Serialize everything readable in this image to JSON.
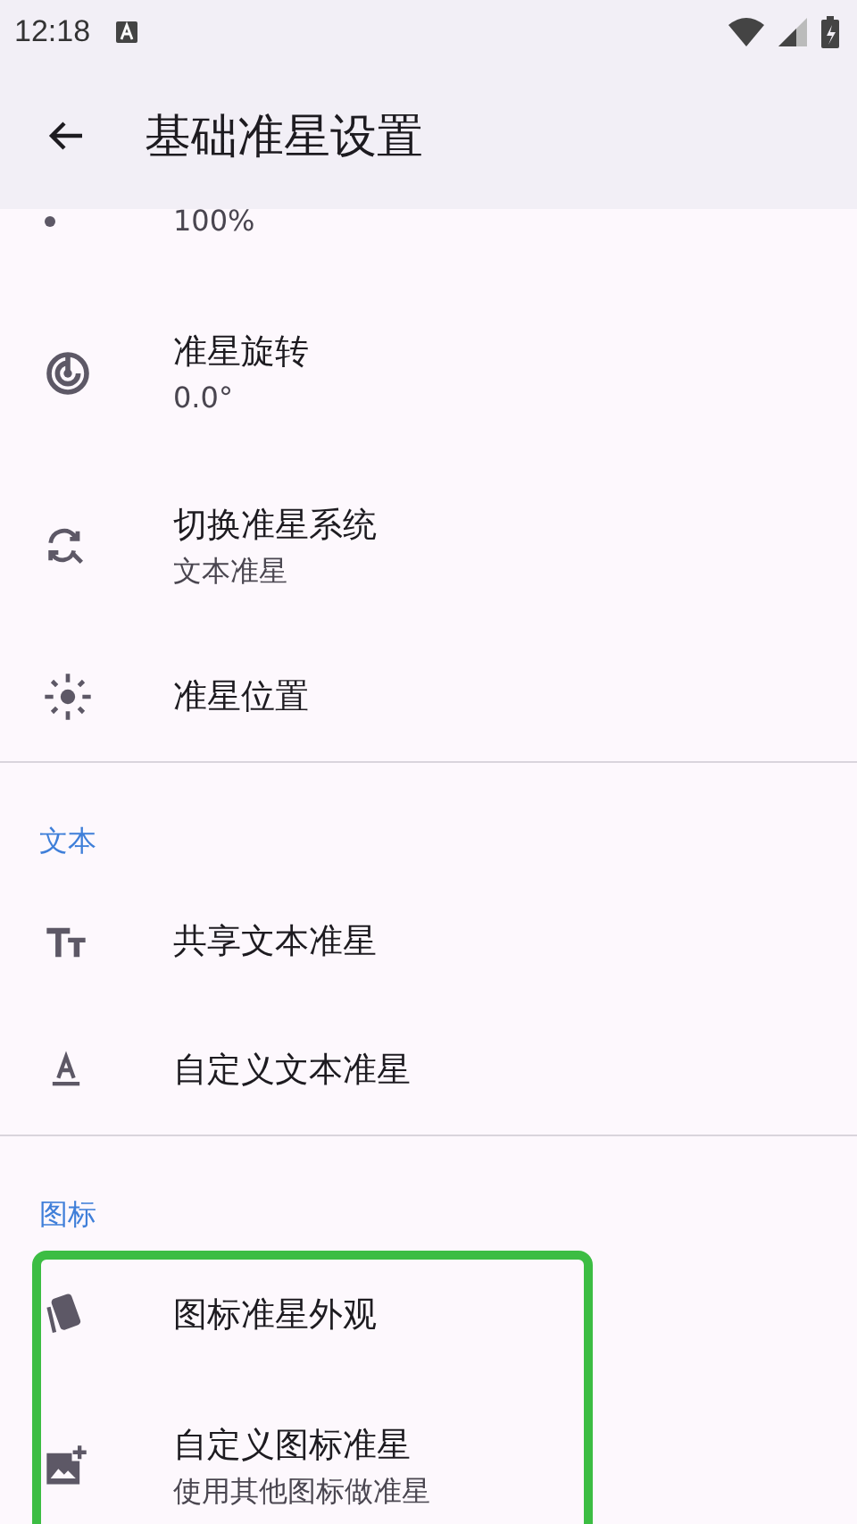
{
  "status_bar": {
    "time": "12:18"
  },
  "app_bar": {
    "title": "基础准星设置"
  },
  "sections": [
    {
      "items": [
        {
          "subtitle": "100%"
        },
        {
          "title": "准星旋转",
          "subtitle": "0.0°"
        },
        {
          "title": "切换准星系统",
          "subtitle": "文本准星"
        },
        {
          "title": "准星位置"
        }
      ]
    },
    {
      "header": "文本",
      "items": [
        {
          "title": "共享文本准星"
        },
        {
          "title": "自定义文本准星"
        }
      ]
    },
    {
      "header": "图标",
      "highlighted": true,
      "items": [
        {
          "title": "图标准星外观"
        },
        {
          "title": "自定义图标准星",
          "subtitle": "使用其他图标做准星"
        }
      ]
    }
  ]
}
